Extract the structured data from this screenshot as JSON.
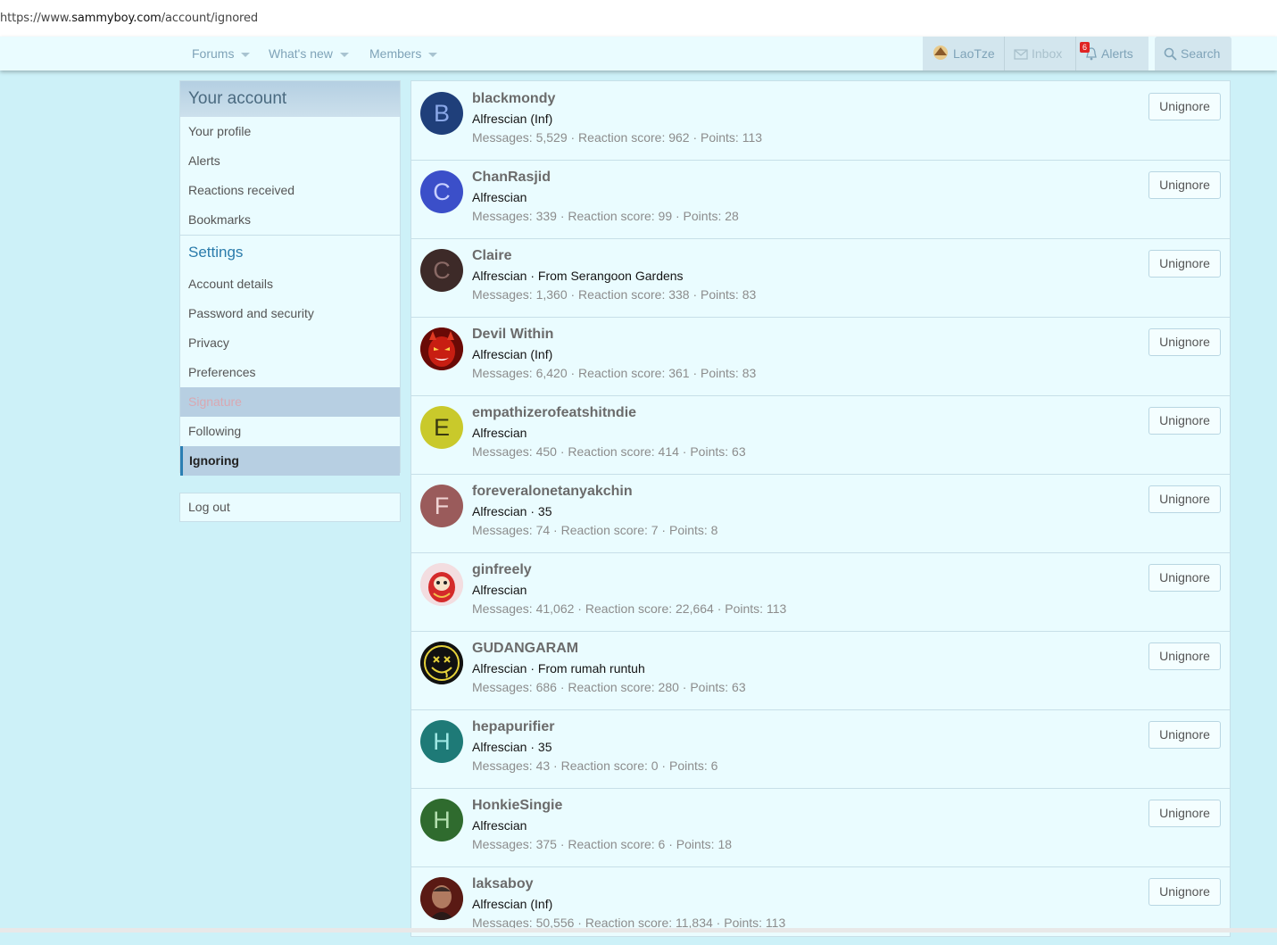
{
  "browser": {
    "url_prefix": "https://www.",
    "url_domain": "sammyboy.com",
    "url_path": "/account/ignored"
  },
  "nav": {
    "forums": "Forums",
    "whats_new": "What's new",
    "members": "Members",
    "user": "LaoTze",
    "inbox": "Inbox",
    "alerts": "Alerts",
    "alerts_count": "6",
    "search": "Search"
  },
  "sidebar": {
    "title": "Your account",
    "account_items": [
      "Your profile",
      "Alerts",
      "Reactions received",
      "Bookmarks"
    ],
    "settings_title": "Settings",
    "settings_items": [
      "Account details",
      "Password and security",
      "Privacy",
      "Preferences",
      "Signature",
      "Following",
      "Ignoring"
    ],
    "logout": "Log out"
  },
  "colors": {
    "accent": "#2b7fb3",
    "background": "#cdf1f8"
  },
  "unignore_label": "Unignore",
  "ignored_users": [
    {
      "name": "blackmondy",
      "title": "Alfrescian (Inf)",
      "stats": "Messages: 5,529 · Reaction score: 962 · Points: 113",
      "letter": "B",
      "color": "#1f3f7a"
    },
    {
      "name": "ChanRasjid",
      "title": "Alfrescian",
      "stats": "Messages: 339 · Reaction score: 99 · Points: 28",
      "letter": "C",
      "color": "#3b4fc9"
    },
    {
      "name": "Claire",
      "title": "Alfrescian · From Serangoon Gardens",
      "stats": "Messages: 1,360 · Reaction score: 338 · Points: 83",
      "letter": "C",
      "color": "#3d2a28"
    },
    {
      "name": "Devil Within",
      "title": "Alfrescian (Inf)",
      "stats": "Messages: 6,420 · Reaction score: 361 · Points: 83",
      "letter": "",
      "color": "#b01a10"
    },
    {
      "name": "empathizerofeatshitndie",
      "title": "Alfrescian",
      "stats": "Messages: 450 · Reaction score: 414 · Points: 63",
      "letter": "E",
      "color": "#c9c92b"
    },
    {
      "name": "foreveralonetanyakchin",
      "title": "Alfrescian · 35",
      "stats": "Messages: 74 · Reaction score: 7 · Points: 8",
      "letter": "F",
      "color": "#9a5b5b"
    },
    {
      "name": "ginfreely",
      "title": "Alfrescian",
      "stats": "Messages: 41,062 · Reaction score: 22,664 · Points: 113",
      "letter": "",
      "color": "#f0d8dc"
    },
    {
      "name": "GUDANGARAM",
      "title": "Alfrescian · From rumah runtuh",
      "stats": "Messages: 686 · Reaction score: 280 · Points: 63",
      "letter": "",
      "color": "#111111"
    },
    {
      "name": "hepapurifier",
      "title": "Alfrescian · 35",
      "stats": "Messages: 43 · Reaction score: 0 · Points: 6",
      "letter": "H",
      "color": "#1e7a77"
    },
    {
      "name": "HonkieSingie",
      "title": "Alfrescian",
      "stats": "Messages: 375 · Reaction score: 6 · Points: 18",
      "letter": "H",
      "color": "#2f6b2e"
    },
    {
      "name": "laksaboy",
      "title": "Alfrescian (Inf)",
      "stats": "Messages: 50,556 · Reaction score: 11,834 · Points: 113",
      "letter": "",
      "color": "#4a2a24"
    }
  ]
}
